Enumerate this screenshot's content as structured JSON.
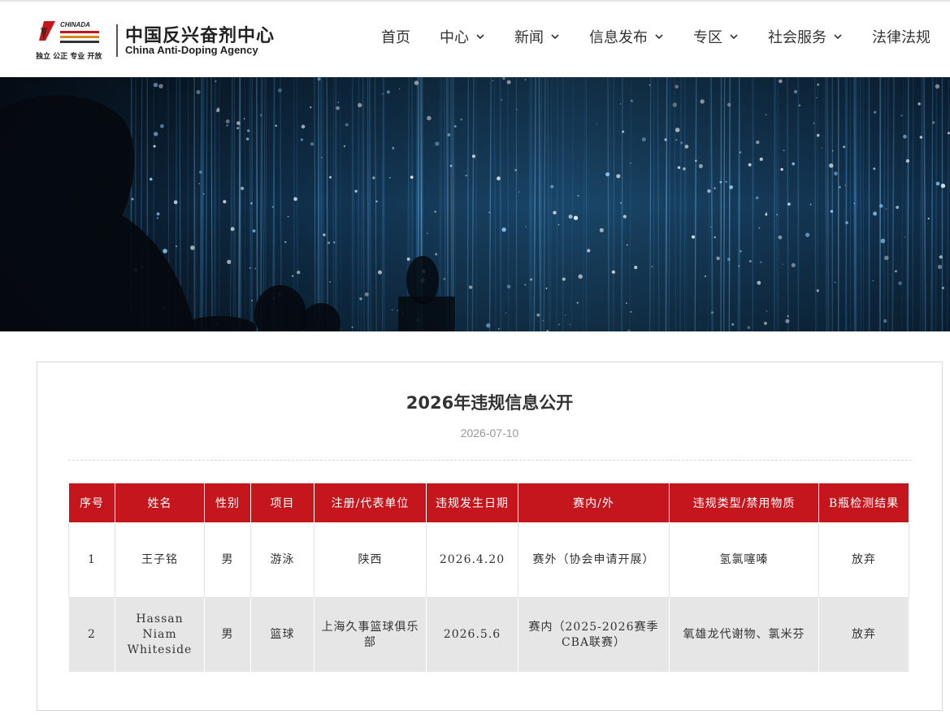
{
  "header": {
    "logo_mark": "CHINADA",
    "logo_cn": "中国反兴奋剂中心",
    "logo_en": "China Anti-Doping Agency",
    "logo_tag": "独立 公正 专业 开放",
    "nav": [
      "首页",
      "中心",
      "新闻",
      "信息发布",
      "专区",
      "社会服务",
      "法律法规"
    ]
  },
  "article": {
    "title": "2026年违规信息公开",
    "date": "2026-07-10"
  },
  "table": {
    "headers": [
      "序号",
      "姓名",
      "性别",
      "项目",
      "注册/代表单位",
      "违规发生日期",
      "赛内/外",
      "违规类型/禁用物质",
      "B瓶检测结果"
    ],
    "rows": [
      [
        "1",
        "王子铭",
        "男",
        "游泳",
        "陕西",
        "2026.4.20",
        "赛外（协会申请开展）",
        "氢氯噻嗪",
        "放弃"
      ],
      [
        "2",
        "Hassan Niam Whiteside",
        "男",
        "篮球",
        "上海久事篮球俱乐部",
        "2026.5.6",
        "赛内（2025-2026赛季CBA联赛）",
        "氧雄龙代谢物、氯米芬",
        "放弃"
      ]
    ]
  },
  "colors": {
    "accent_red": "#c4161c",
    "banner_dark": "#0b1a2b"
  }
}
